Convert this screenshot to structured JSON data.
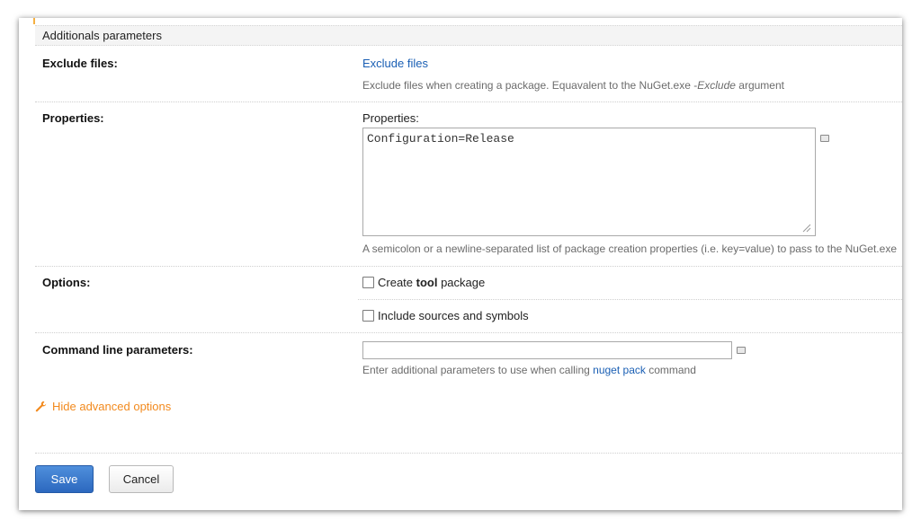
{
  "section_title": "Additionals parameters",
  "exclude": {
    "label": "Exclude files:",
    "link": "Exclude files",
    "help_prefix": "Exclude files when creating a package. Equavalent to the NuGet.exe -",
    "help_em": "Exclude",
    "help_suffix": " argument"
  },
  "properties": {
    "label": "Properties:",
    "caption": "Properties:",
    "value": "Configuration=Release",
    "help": "A semicolon or a newline-separated list of package creation properties (i.e. key=value) to pass to the NuGet.exe"
  },
  "options": {
    "label": "Options:",
    "tool_prefix": "Create ",
    "tool_bold": "tool",
    "tool_suffix": " package",
    "tool_checked": false,
    "symbols_label": "Include sources and symbols",
    "symbols_checked": false
  },
  "cmdline": {
    "label": "Command line parameters:",
    "value": "",
    "help_prefix": "Enter additional parameters to use when calling ",
    "help_link": "nuget pack",
    "help_suffix": " command"
  },
  "advanced": {
    "label": "Hide advanced options",
    "icon": "wrench-icon",
    "color": "#f28a1e"
  },
  "buttons": {
    "save": "Save",
    "cancel": "Cancel"
  }
}
